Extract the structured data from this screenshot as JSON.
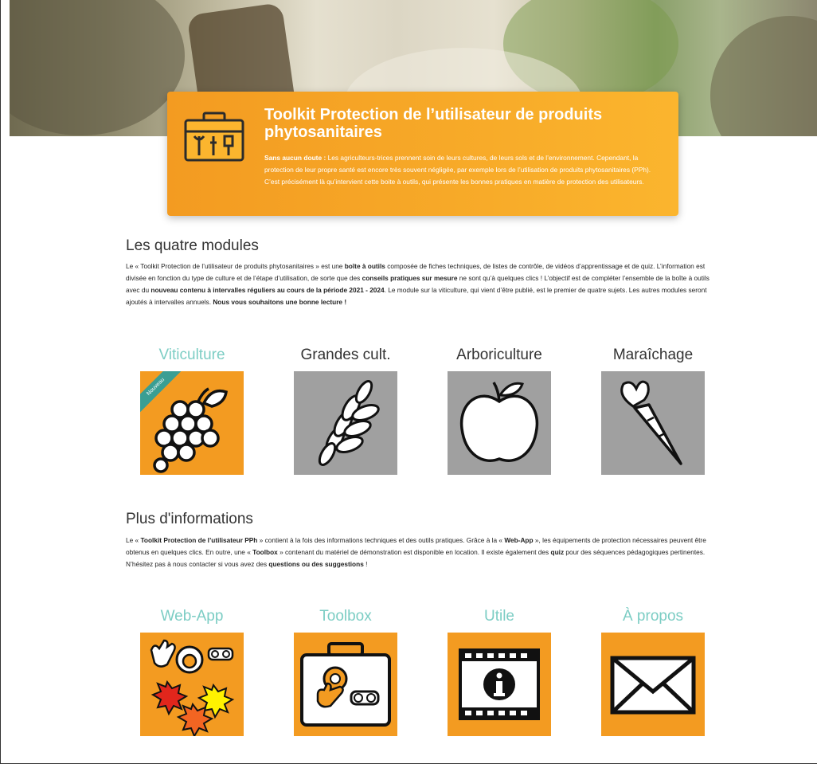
{
  "banner": {
    "title": "Toolkit Protection de l’utilisateur de produits phytosanitaires",
    "intro_bold": "Sans aucun doute :",
    "intro_text": " Les agriculteurs-trices prennent soin de leurs cultures, de leurs sols et de l’environnement. Cependant, la protection de leur propre santé est encore très souvent négligée, par exemple lors de l’utilisation de produits phytosanitaires (PPh). C’est précisément là qu’intervient cette boite à outils, qui présente les bonnes pratiques en matière de protection des utilisateurs."
  },
  "modules": {
    "title": "Les quatre modules",
    "p1": "Le « Toolkit Protection de l’utilisateur de produits phytosanitaires » est une ",
    "b1": "boîte à outils",
    "p2": " composée de fiches techniques, de listes de contrôle, de vidéos d’apprentissage et de quiz. L’information est divisée en fonction du type de culture et de l’étape d’utilisation, de sorte que des ",
    "b2": "conseils pratiques sur mesure",
    "p3": " ne sont qu’à quelques clics ! L’objectif est de compléter l’ensemble de la boîte à outils avec du ",
    "b3": "nouveau contenu à intervalles réguliers au cours de la période 2021 - 2024",
    "p4": ". Le module sur la viticulture, qui vient d’être publié, est le premier de quatre sujets. Les autres modules seront ajoutés à intervalles annuels. ",
    "b4": "Nous vous souhaitons une bonne lecture !",
    "tiles": [
      {
        "label": "Viticulture",
        "badge": "Nouveau",
        "icon": "grapes-icon"
      },
      {
        "label": "Grandes cult.",
        "icon": "wheat-icon"
      },
      {
        "label": "Arboriculture",
        "icon": "apple-icon"
      },
      {
        "label": "Maraîchage",
        "icon": "carrot-icon"
      }
    ]
  },
  "info": {
    "title": "Plus d'informations",
    "p1": "Le « ",
    "b1": "Toolkit Protection de l’utilisateur PPh",
    "p2": " » contient à la fois des informations techniques et des outils pratiques. Grâce à la « ",
    "b2": "Web-App",
    "p3": " », les équipements de protection nécessaires peuvent être obtenus en quelques clics. En outre, une « ",
    "b3": "Toolbox",
    "p4": " » contenant du matériel de démonstration est disponible en location. Il existe également des ",
    "b4": "quiz",
    "p5": " pour des séquences pédagogiques pertinentes. N’hésitez pas à nous contacter si vous avez des ",
    "b5": "questions ou des suggestions",
    "p6": " !",
    "tiles": [
      {
        "label": "Web-App",
        "icon": "protective-gear-icon"
      },
      {
        "label": "Toolbox",
        "icon": "toolbox-icon"
      },
      {
        "label": "Utile",
        "icon": "info-film-icon"
      },
      {
        "label": "À propos",
        "icon": "envelope-icon"
      }
    ]
  },
  "colors": {
    "accent": "#f39b21",
    "teal": "#7ccdc4",
    "grey_tile": "#a0a0a0",
    "ribbon": "#3a9e93"
  }
}
